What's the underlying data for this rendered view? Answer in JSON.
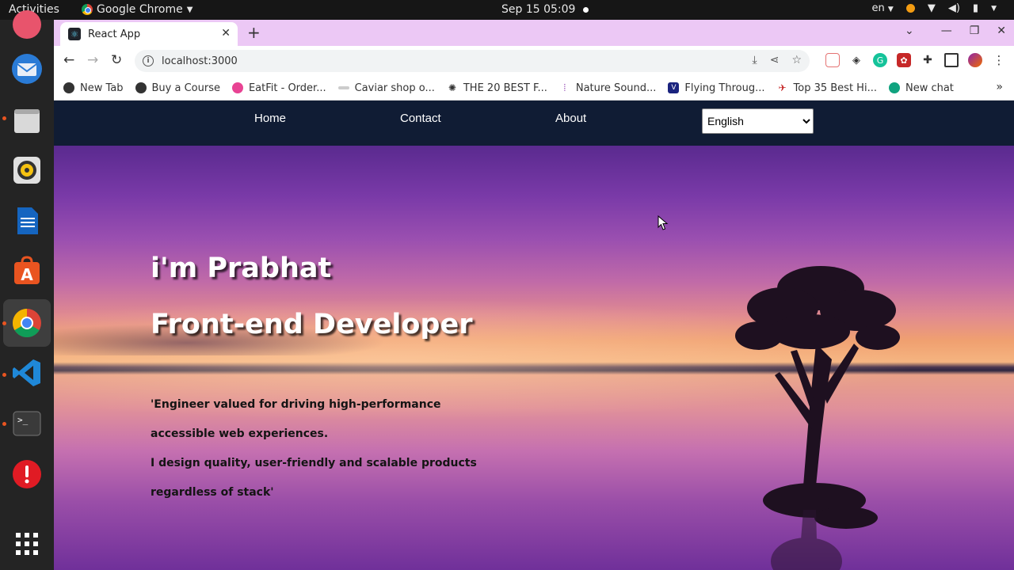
{
  "os": {
    "activities": "Activities",
    "app_name": "Google Chrome",
    "clock": "Sep 15  05:09",
    "lang": "en",
    "colors": {
      "dock_accent": "#e95420",
      "notification": "#f39c12"
    }
  },
  "dock": {
    "items": [
      {
        "name": "thunderbird-icon"
      },
      {
        "name": "files-icon"
      },
      {
        "name": "rhythmbox-icon"
      },
      {
        "name": "libreoffice-writer-icon"
      },
      {
        "name": "app-center-icon"
      },
      {
        "name": "chrome-icon"
      },
      {
        "name": "vscode-icon"
      },
      {
        "name": "terminal-icon"
      },
      {
        "name": "help-icon"
      },
      {
        "name": "show-apps-icon"
      }
    ]
  },
  "browser": {
    "tab_title": "React App",
    "url": "localhost:3000",
    "bookmarks": [
      "New Tab",
      "Buy a Course",
      "EatFit - Order...",
      "Caviar shop o...",
      "THE 20 BEST F...",
      "Nature Sound...",
      "Flying Throug...",
      "Top 35 Best Hi...",
      "New chat"
    ],
    "more": "»"
  },
  "site": {
    "nav": {
      "home": "Home",
      "contact": "Contact",
      "about": "About"
    },
    "language": {
      "selected": "English",
      "options": [
        "English"
      ]
    },
    "hero": {
      "line1": "i'm Prabhat",
      "line2": "Front-end Developer",
      "p1": "'Engineer valued for driving high-performance",
      "p2": "accessible web experiences.",
      "p3": "I design quality, user-friendly and scalable products",
      "p4": "regardless of stack'"
    },
    "colors": {
      "nav_bg": "#101c34"
    }
  }
}
